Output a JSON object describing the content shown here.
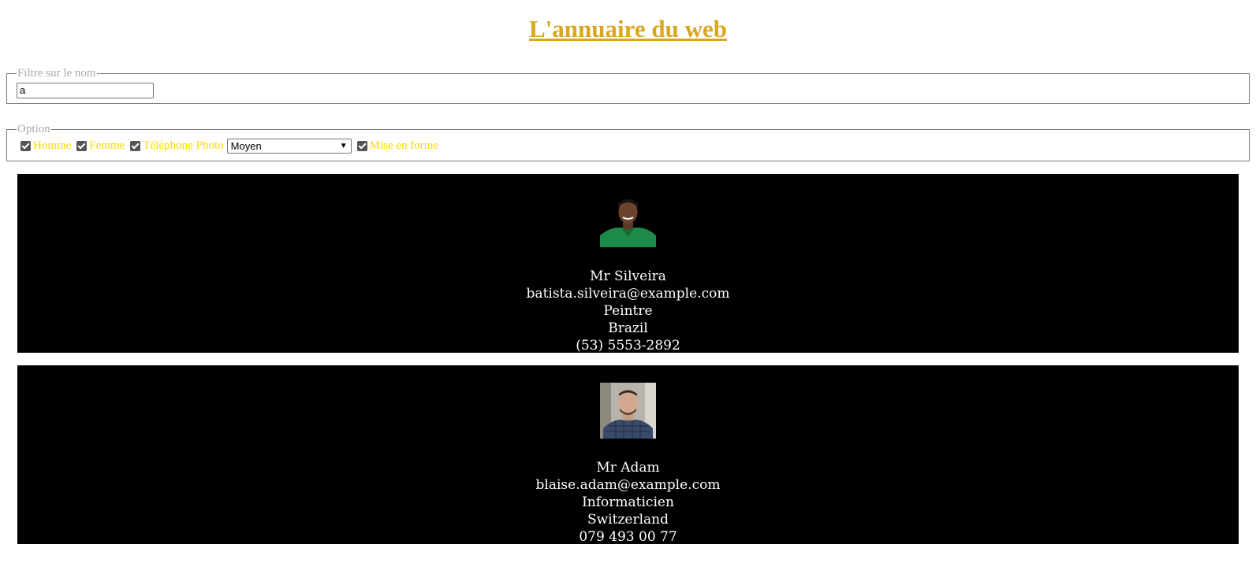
{
  "page": {
    "title": "L'annuaire du web"
  },
  "filter": {
    "legend": "Filtre sur le nom",
    "value": "a"
  },
  "options": {
    "legend": "Option",
    "homme": "Homme",
    "femme": "Femme",
    "telephone": "Téléphone",
    "photo": "Photo",
    "photo_size": "Moyen",
    "mise_en_forme": "Mise en forme",
    "colors": {
      "title": "#DAA520",
      "option_label": "#FFD700",
      "legend": "#a9a9a9",
      "card_bg": "#000000"
    }
  },
  "people": [
    {
      "name": "Mr Silveira",
      "email": "batista.silveira@example.com",
      "job": "Peintre",
      "country": "Brazil",
      "phone": "(53) 5553-2892",
      "photo": "man-green-shirt-photo"
    },
    {
      "name": "Mr Adam",
      "email": "blaise.adam@example.com",
      "job": "Informaticien",
      "country": "Switzerland",
      "phone": "079 493 00 77",
      "photo": "man-plaid-shirt-photo"
    }
  ]
}
